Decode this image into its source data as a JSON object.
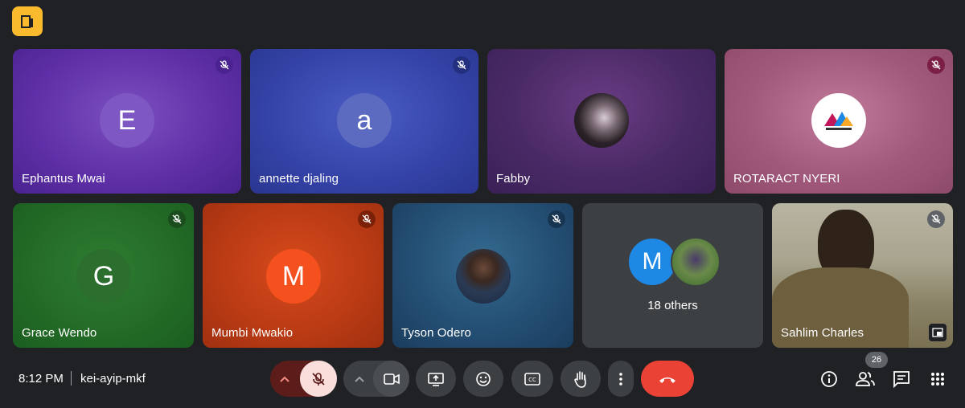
{
  "participants": [
    {
      "name": "Ephantus Mwai",
      "initial": "E"
    },
    {
      "name": "annette djaling",
      "initial": "a"
    },
    {
      "name": "Fabby"
    },
    {
      "name": "ROTARACT NYERI"
    },
    {
      "name": "Grace Wendo",
      "initial": "G"
    },
    {
      "name": "Mumbi Mwakio",
      "initial": "M"
    },
    {
      "name": "Tyson Odero"
    },
    {
      "name": "Sahlim Charles"
    }
  ],
  "others": {
    "initial": "M",
    "label": "18 others"
  },
  "meeting": {
    "time": "8:12 PM",
    "code": "kei-ayip-mkf"
  },
  "people_count": "26",
  "colors": {
    "leave": "#ea4335",
    "mic_off_bg": "#f9dedc",
    "badge": "#f9bb2d"
  }
}
